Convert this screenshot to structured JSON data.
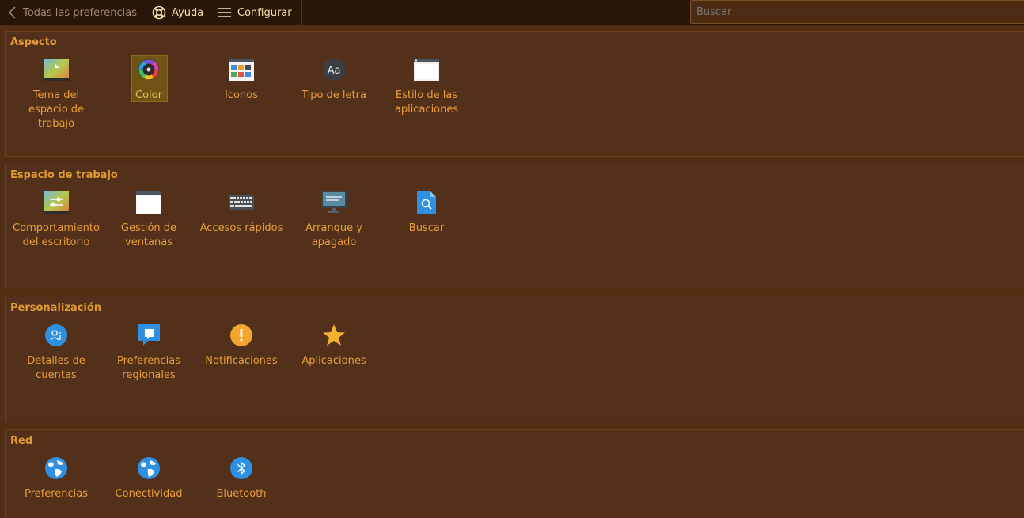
{
  "toolbar": {
    "back_label": "Todas las preferencias",
    "help_label": "Ayuda",
    "configure_label": "Configurar",
    "search_placeholder": "Buscar"
  },
  "colors": {
    "background": "#522e14",
    "toolbar": "#2a1609",
    "accent_text": "#e89e3a",
    "selection": "#6f5416"
  },
  "sections": [
    {
      "title": "Aspecto",
      "items": [
        {
          "label": "Tema del espacio de trabajo",
          "icon": "workspace-theme-icon"
        },
        {
          "label": "Color",
          "icon": "color-icon",
          "selected": true
        },
        {
          "label": "Iconos",
          "icon": "icons-icon"
        },
        {
          "label": "Tipo de letra",
          "icon": "font-icon"
        },
        {
          "label": "Estilo de las aplicaciones",
          "icon": "app-style-icon"
        }
      ]
    },
    {
      "title": "Espacio de trabajo",
      "items": [
        {
          "label": "Comportamiento del escritorio",
          "icon": "desktop-behavior-icon"
        },
        {
          "label": "Gestión de ventanas",
          "icon": "window-management-icon"
        },
        {
          "label": "Accesos rápidos",
          "icon": "keyboard-icon"
        },
        {
          "label": "Arranque y apagado",
          "icon": "startup-shutdown-icon"
        },
        {
          "label": "Buscar",
          "icon": "search-file-icon"
        }
      ]
    },
    {
      "title": "Personalización",
      "items": [
        {
          "label": "Detalles de cuentas",
          "icon": "user-account-icon"
        },
        {
          "label": "Preferencias regionales",
          "icon": "regional-icon"
        },
        {
          "label": "Notificaciones",
          "icon": "notification-icon"
        },
        {
          "label": "Aplicaciones",
          "icon": "star-icon"
        }
      ]
    },
    {
      "title": "Red",
      "items": [
        {
          "label": "Preferencias",
          "icon": "globe-icon"
        },
        {
          "label": "Conectividad",
          "icon": "globe-icon"
        },
        {
          "label": "Bluetooth",
          "icon": "bluetooth-icon"
        }
      ]
    }
  ]
}
